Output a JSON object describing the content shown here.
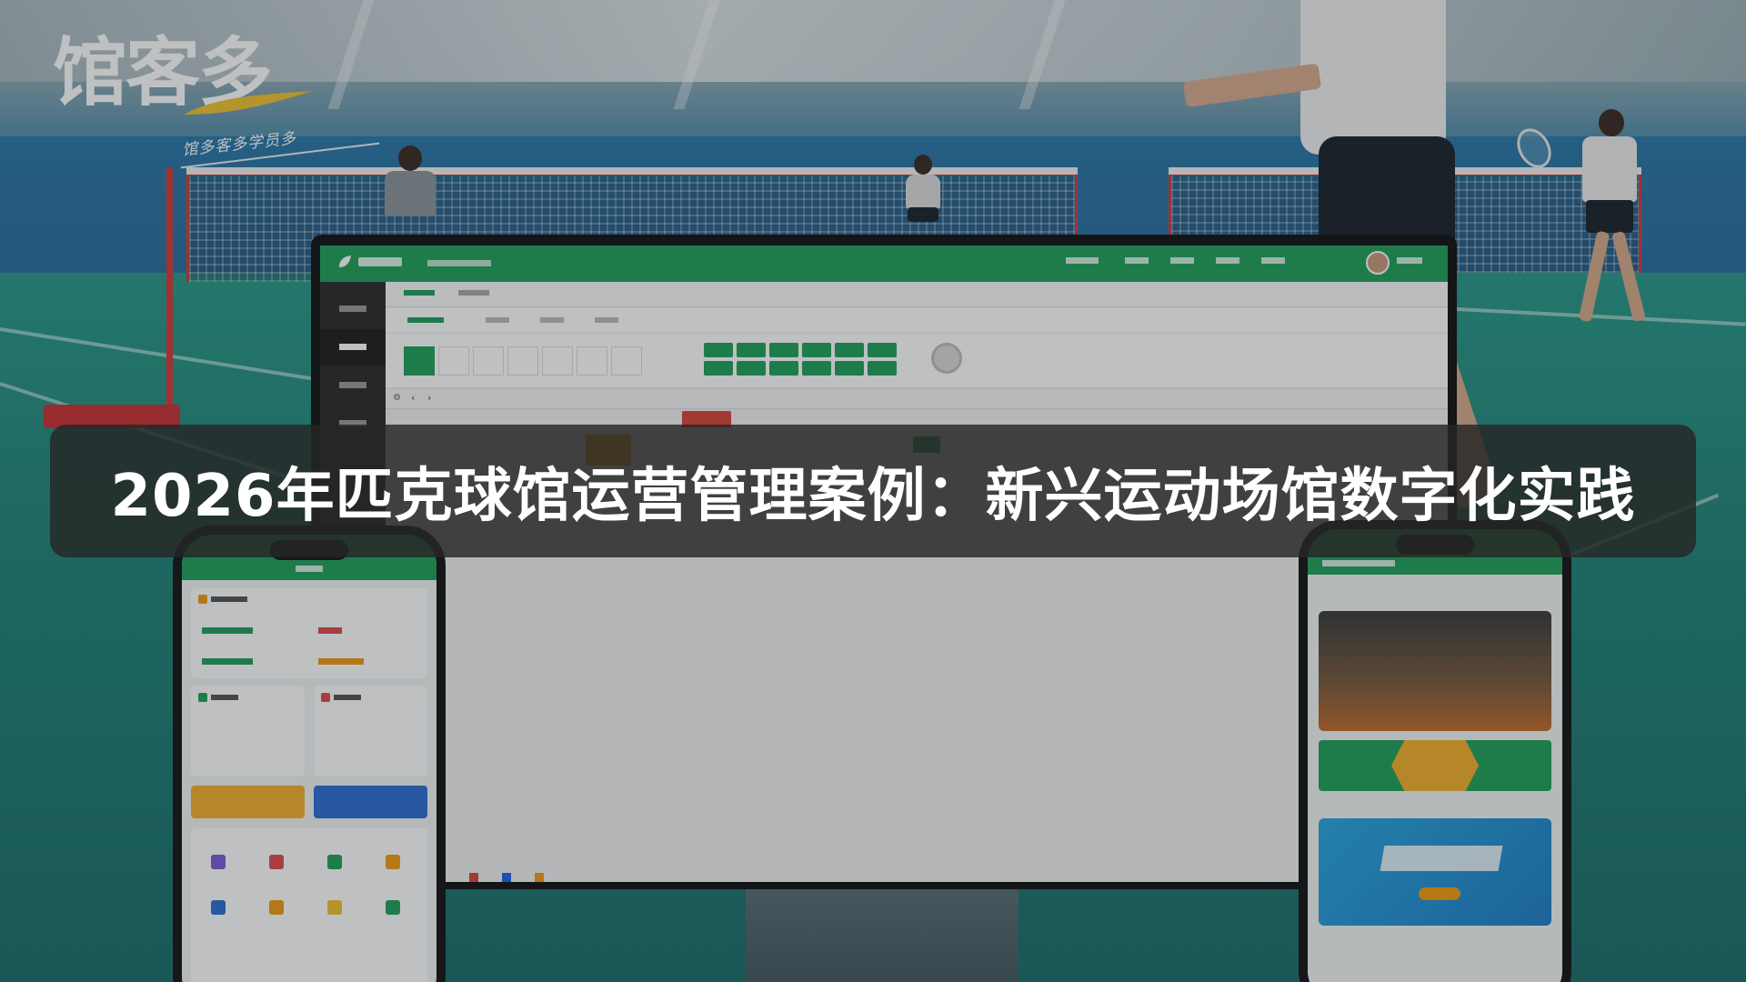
{
  "logo": {
    "main": "馆客多",
    "slogan": "馆多客多学员多"
  },
  "headline": "2026年匹克球馆运营管理案例：新兴运动场馆数字化实践",
  "colors": {
    "brand_green": "#22a15a",
    "overlay_bar": "#262626",
    "headline_text": "#ffffff",
    "logo_swoosh": "#f2c230",
    "booked_orange": "#f39c12",
    "booked_red": "#d9443a"
  },
  "icons": [
    "swoosh-icon",
    "leaf-icon",
    "user-avatar-icon",
    "chevron-left-icon",
    "chevron-right-icon",
    "settings-icon"
  ]
}
